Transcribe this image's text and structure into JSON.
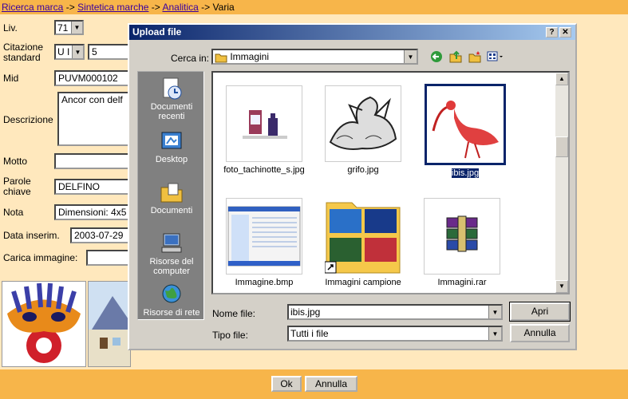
{
  "breadcrumb": {
    "link1": "Ricerca marca",
    "link2": "Sintetica marche",
    "link3": "Analitica",
    "current": "Varia",
    "separator": "->"
  },
  "form": {
    "liv_label": "Liv.",
    "liv_value": "71",
    "citazione_label": "Citazione standard",
    "citazione_select": "U I",
    "citazione_value": "5",
    "mid_label": "Mid",
    "mid_value": "PUVM000102",
    "descrizione_label": "Descrizione",
    "descrizione_value": "Ancor con delf",
    "motto_label": "Motto",
    "motto_value": "",
    "parole_label": "Parole chiave",
    "parole_value": "DELFINO",
    "nota_label": "Nota",
    "nota_value": "Dimensioni: 4x5",
    "data_label": "Data inserim.",
    "data_value": "2003-07-29",
    "carica_label": "Carica immagine:",
    "carica_value": ""
  },
  "bottom": {
    "ok_label": "Ok",
    "annulla_label": "Annulla"
  },
  "dialog": {
    "title": "Upload file",
    "help_label": "?",
    "close_label": "✕",
    "cerca_label": "Cerca in:",
    "cerca_value": "Immagini",
    "places": [
      "Documenti recenti",
      "Desktop",
      "Documenti",
      "Risorse del computer",
      "Risorse di rete"
    ],
    "files": [
      "foto_tachinotte_s.jpg",
      "grifo.jpg",
      "ibis.jpg",
      "Immagine.bmp",
      "Immagini campione",
      "Immagini.rar"
    ],
    "nomefile_label": "Nome file:",
    "nomefile_value": "ibis.jpg",
    "tipofile_label": "Tipo file:",
    "tipofile_value": "Tutti i file",
    "apri_label": "Apri",
    "annulla_label": "Annulla"
  },
  "colors": {
    "page_bg": "#FFE8BD",
    "bar_bg": "#F7B54A",
    "title_start": "#0A246A",
    "title_end": "#A6CAF0",
    "selection": "#0A246A"
  }
}
